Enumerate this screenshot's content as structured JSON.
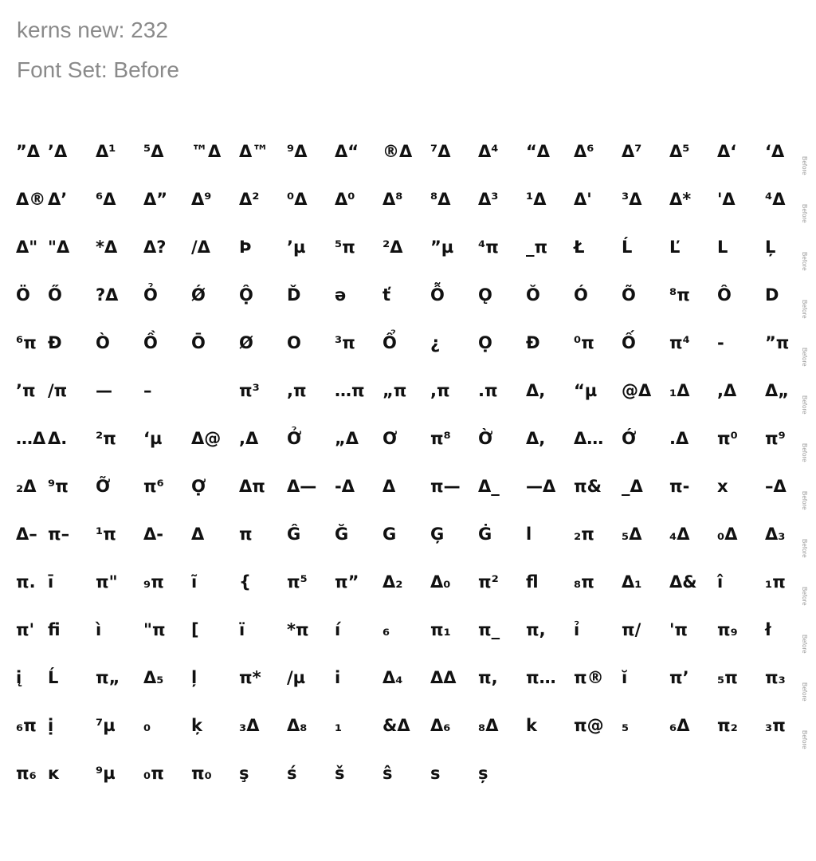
{
  "header": {
    "kerns": "kerns new: 232",
    "font_set": "Font Set: Before"
  },
  "row_tag": "Before",
  "rows": [
    [
      "”Δ",
      "’Δ",
      "Δ¹",
      "⁵Δ",
      "™Δ",
      "Δ™",
      "⁹Δ",
      "Δ“",
      "®Δ",
      "⁷Δ",
      "Δ⁴",
      "“Δ",
      "Δ⁶",
      "Δ⁷",
      "Δ⁵",
      "Δ‘",
      "‘Δ"
    ],
    [
      "Δ®",
      "Δ’",
      "⁶Δ",
      "Δ”",
      "Δ⁹",
      "Δ²",
      "⁰Δ",
      "Δ⁰",
      "Δ⁸",
      "⁸Δ",
      "Δ³",
      "¹Δ",
      "Δ'",
      "³Δ",
      "Δ*",
      "'Δ",
      "⁴Δ"
    ],
    [
      "Δ\"",
      "\"Δ",
      "*Δ",
      "Δ?",
      "/Δ",
      "Þ",
      "’µ",
      "⁵π",
      "²Δ",
      "”µ",
      "⁴π",
      "_π",
      "Ł",
      "Ĺ",
      "Ľ",
      "L",
      "Ļ"
    ],
    [
      "Ö",
      "Ő",
      "?Δ",
      "Ỏ",
      "Ǿ",
      "Ộ",
      "Ď",
      "ə",
      "ť",
      "Ỗ",
      "Ǫ",
      "Ǒ",
      "Ó",
      "Õ",
      "⁸π",
      "Ô",
      "D"
    ],
    [
      "⁶π",
      "Đ",
      "Ò",
      "Ồ",
      "Ō",
      "Ø",
      "O",
      "³π",
      "Ổ",
      "¿",
      "Ọ",
      "Ð",
      "⁰π",
      "Ố",
      "π⁴",
      "-",
      "”π"
    ],
    [
      "’π",
      "/π",
      "—",
      "–",
      "",
      "π³",
      ",π",
      "…π",
      "„π",
      ",π",
      ".π",
      "Δ,",
      "“µ",
      "@Δ",
      "₁Δ",
      ",Δ",
      "Δ„"
    ],
    [
      "…Δ",
      "Δ.",
      "²π",
      "‘µ",
      "Δ@",
      ",Δ",
      "Ở",
      "„Δ",
      "Ơ",
      "π⁸",
      "Ờ",
      "Δ,",
      "Δ…",
      "Ớ",
      ".Δ",
      "π⁰",
      "π⁹"
    ],
    [
      "₂Δ",
      "⁹π",
      "Ỡ",
      "π⁶",
      "Ợ",
      "Δπ",
      "Δ—",
      "-Δ",
      "Δ",
      "π—",
      "Δ_",
      "—Δ",
      "π&",
      "_Δ",
      "π-",
      "x",
      "–Δ"
    ],
    [
      "Δ–",
      "π–",
      "¹π",
      "Δ-",
      "Δ",
      "π",
      "Ĝ",
      "Ğ",
      "G",
      "Ģ",
      "Ġ",
      "l",
      "₂π",
      "₅Δ",
      "₄Δ",
      "₀Δ",
      "Δ₃"
    ],
    [
      "π.",
      "ī",
      "π\"",
      "₉π",
      "ĩ",
      "{",
      "π⁵",
      "π”",
      "Δ₂",
      "Δ₀",
      "π²",
      "fl",
      "₈π",
      "Δ₁",
      "Δ&",
      "î",
      "₁π"
    ],
    [
      "π'",
      "fi",
      "ì",
      "\"π",
      "[",
      "ï",
      "*π",
      "í",
      "₆",
      "π₁",
      "π_",
      "π,",
      "ỉ",
      "π/",
      "'π",
      "π₉",
      "ł"
    ],
    [
      "į",
      "Ĺ",
      "π„",
      "Δ₅",
      "ļ",
      "π*",
      "/µ",
      "i",
      "Δ₄",
      "ΔΔ",
      "π,",
      "π…",
      "π®",
      "ĭ",
      "π’",
      "₅π",
      "π₃"
    ],
    [
      "₆π",
      "ị",
      "⁷µ",
      "₀",
      "ķ",
      "₃Δ",
      "Δ₈",
      "₁",
      "&Δ",
      "Δ₆",
      "₈Δ",
      "k",
      "π@",
      "₅",
      "₆Δ",
      "π₂",
      "₃π"
    ],
    [
      "π₆",
      "ĸ",
      "⁹µ",
      "₀π",
      "π₀",
      "ş",
      "ś",
      "š",
      "ŝ",
      "s",
      "ș"
    ]
  ]
}
